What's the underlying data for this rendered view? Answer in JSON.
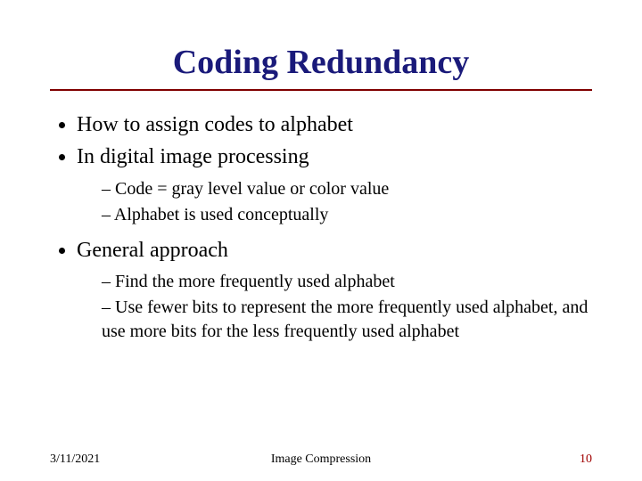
{
  "title": "Coding Redundancy",
  "bullets": {
    "b1": "How to assign codes to alphabet",
    "b2": "In digital image processing",
    "b2_sub": {
      "s1": "Code = gray level value or color value",
      "s2": "Alphabet is used conceptually"
    },
    "b3": "General approach",
    "b3_sub": {
      "s1": "Find the more frequently used alphabet",
      "s2": "Use fewer bits to represent the more frequently used alphabet, and use more bits for the less frequently used alphabet"
    }
  },
  "footer": {
    "date": "3/11/2021",
    "topic": "Image Compression",
    "page": "10"
  }
}
